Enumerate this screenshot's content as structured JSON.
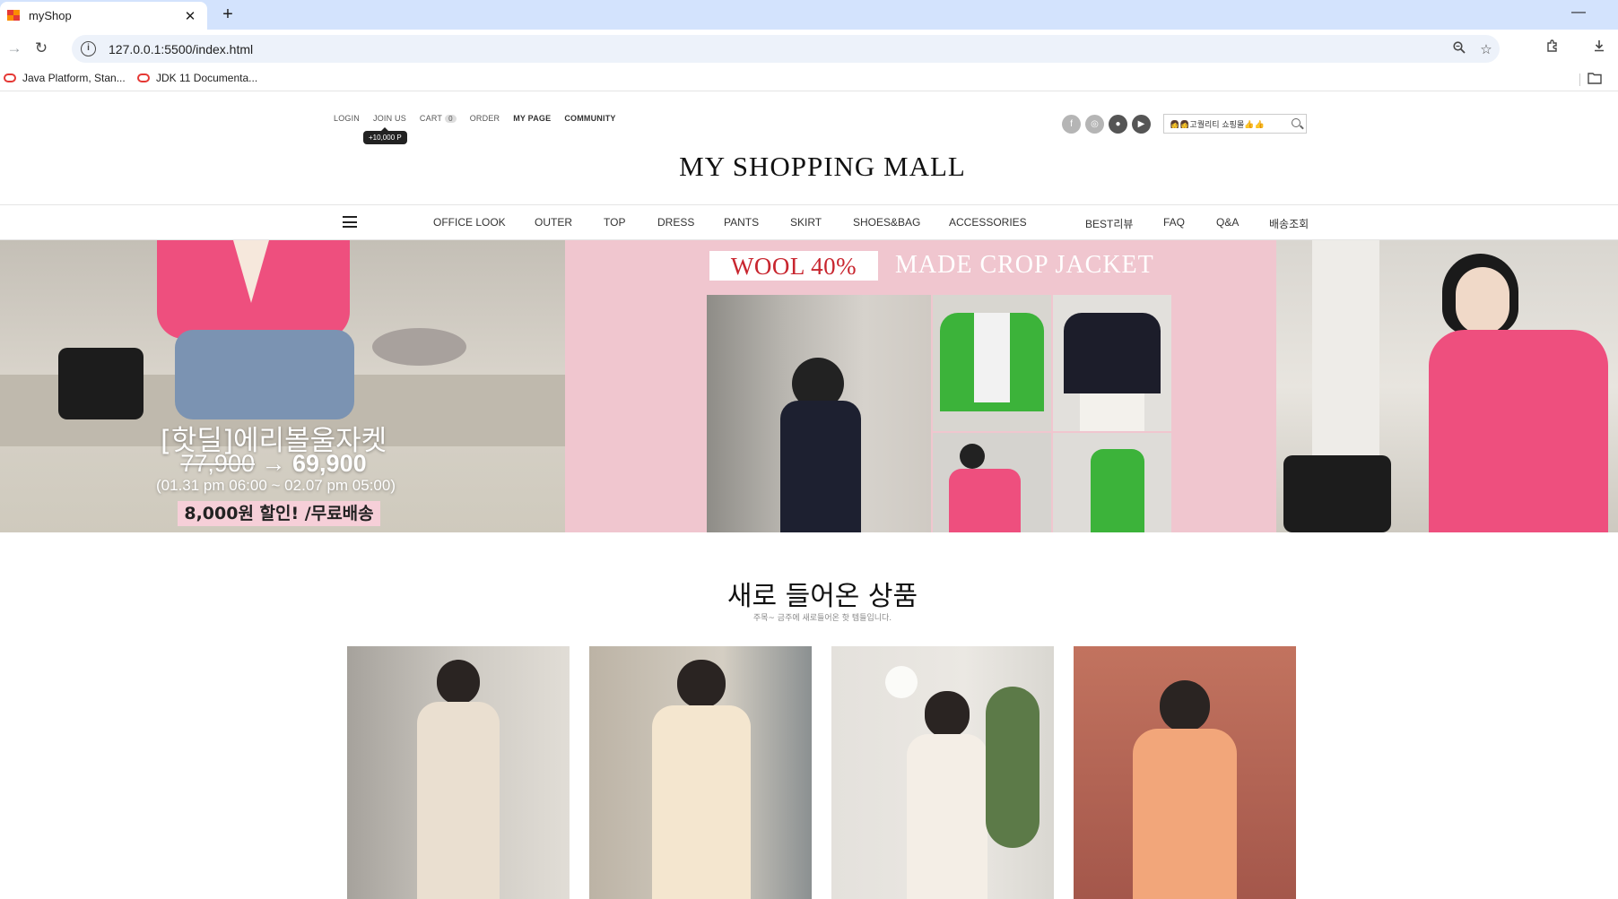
{
  "browser": {
    "tab_title": "myShop",
    "url": "127.0.0.1:5500/index.html",
    "bookmarks": [
      "Java Platform, Stan...",
      "JDK 11 Documenta..."
    ],
    "colors": {
      "tabbar": "#d3e3fd",
      "omnibox": "#edf2fa"
    }
  },
  "header": {
    "util_menu": {
      "login": "LOGIN",
      "join": "JOIN US",
      "cart": "CART",
      "cart_count": "0",
      "order": "ORDER",
      "mypage": "MY PAGE",
      "community": "COMMUNITY"
    },
    "point_bubble": "+10,000 P",
    "search": {
      "value": "👩‍👩고퀄리티 쇼핑몰👍👍"
    },
    "sns_icons": [
      "facebook-icon",
      "instagram-icon",
      "kakao-icon",
      "youtube-icon"
    ],
    "logo": "MY SHOPPING MALL"
  },
  "nav": {
    "items": [
      "OFFICE LOOK",
      "OUTER",
      "TOP",
      "DRESS",
      "PANTS",
      "SKIRT",
      "SHOES&BAG",
      "ACCESSORIES",
      "BEST리뷰",
      "FAQ",
      "Q&A",
      "배송조회"
    ]
  },
  "banner": {
    "promo": {
      "title": "[핫딜]에리볼울자켓",
      "old_price": "77,900",
      "arrow": "→",
      "new_price": "69,900",
      "period": "(01.31 pm 06:00 ~ 02.07 pm 05:00)",
      "badge": "8,000원 할인! /무료배송"
    },
    "center": {
      "wool": "WOOL 40%",
      "title": "MADE CROP JACKET"
    },
    "colors": {
      "pink_bg": "#f0c6cf",
      "jacket_pink": "#ee4f7e",
      "jacket_green": "#3cb33a"
    }
  },
  "new_arrivals": {
    "title": "새로 들어온 상품",
    "subtitle": "주목~ 금주에 새로들어온 핫 템들입니다."
  }
}
